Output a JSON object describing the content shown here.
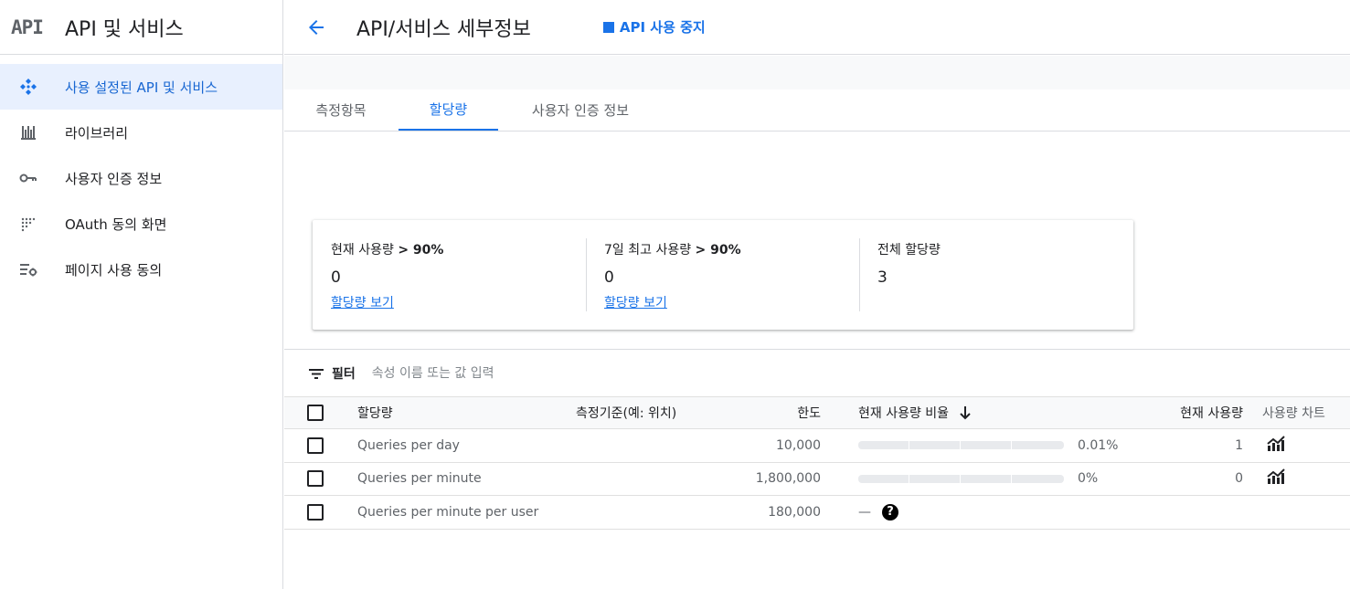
{
  "sidebar": {
    "logo": "API",
    "title": "API 및 서비스",
    "items": [
      {
        "label": "사용 설정된 API 및 서비스",
        "icon": "api-diamond-icon"
      },
      {
        "label": "라이브러리",
        "icon": "library-icon"
      },
      {
        "label": "사용자 인증 정보",
        "icon": "key-icon"
      },
      {
        "label": "OAuth 동의 화면",
        "icon": "oauth-dots-icon"
      },
      {
        "label": "페이지 사용 동의",
        "icon": "settings-list-icon"
      }
    ]
  },
  "header": {
    "title": "API/서비스 세부정보",
    "disable_label": "API 사용 중지"
  },
  "tabs": [
    {
      "label": "측정항목",
      "active": false
    },
    {
      "label": "할당량",
      "active": true
    },
    {
      "label": "사용자 인증 정보",
      "active": false
    }
  ],
  "summary": {
    "current": {
      "label_prefix": "현재 사용량 ",
      "label_bold": "> 90%",
      "value": "0",
      "link": "할당량 보기"
    },
    "peak": {
      "label_prefix": "7일 최고 사용량 ",
      "label_bold": "> 90%",
      "value": "0",
      "link": "할당량 보기"
    },
    "total": {
      "label": "전체 할당량",
      "value": "3"
    }
  },
  "filter": {
    "label": "필터",
    "placeholder": "속성 이름 또는 값 입력"
  },
  "table": {
    "headers": {
      "quota": "할당량",
      "dimension": "측정기준(예: 위치)",
      "limit": "한도",
      "usage_ratio": "현재 사용량 비율",
      "current_usage": "현재 사용량",
      "usage_chart": "사용량 차트"
    },
    "rows": [
      {
        "quota": "Queries per day",
        "dimension": "",
        "limit": "10,000",
        "ratio_text": "0.01%",
        "ratio_value": 0.0001,
        "usage": "1",
        "has_bar": true
      },
      {
        "quota": "Queries per minute",
        "dimension": "",
        "limit": "1,800,000",
        "ratio_text": "0%",
        "ratio_value": 0,
        "usage": "0",
        "has_bar": true
      },
      {
        "quota": "Queries per minute per user",
        "dimension": "",
        "limit": "180,000",
        "ratio_text": "—",
        "ratio_value": null,
        "usage": "",
        "has_bar": false
      }
    ]
  },
  "colors": {
    "accent": "#1a73e8",
    "active_bg": "#e8f0fe"
  }
}
